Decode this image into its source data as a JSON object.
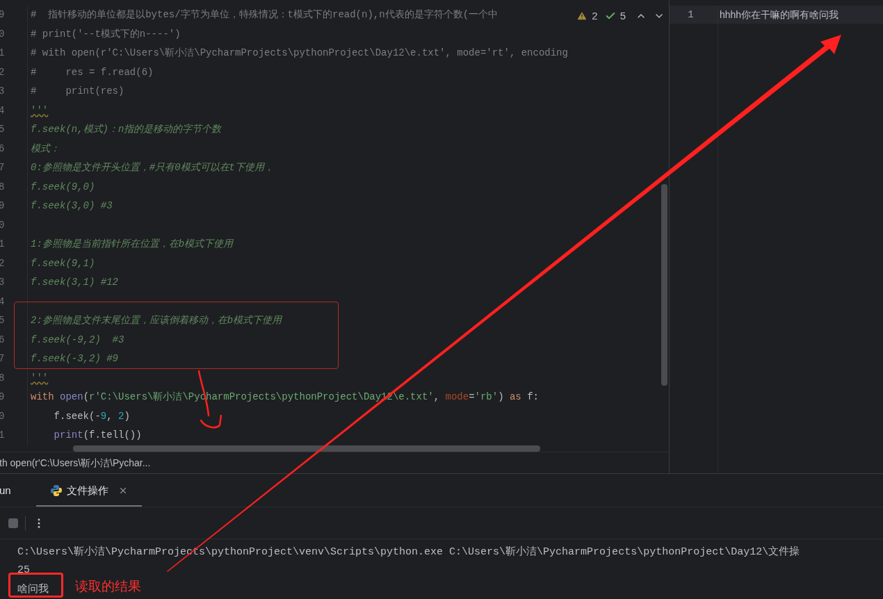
{
  "editor": {
    "lines": [
      {
        "number": "9",
        "segments": [
          {
            "kind": "comment",
            "text": "#  指针移动的单位都是以bytes/字节为单位，特殊情况：t模式下的read(n),n代表的是字符个数(一个中"
          }
        ]
      },
      {
        "number": "0",
        "segments": [
          {
            "kind": "comment",
            "text": "# print('--t模式下的n----')"
          }
        ]
      },
      {
        "number": "1",
        "segments": [
          {
            "kind": "comment",
            "text": "# with open(r'C:\\Users\\靳小洁\\PycharmProjects\\pythonProject\\Day12\\e.txt', mode='rt', encoding"
          }
        ]
      },
      {
        "number": "2",
        "segments": [
          {
            "kind": "comment",
            "text": "#     res = f.read(6)"
          }
        ]
      },
      {
        "number": "3",
        "segments": [
          {
            "kind": "comment",
            "text": "#     print(res)"
          }
        ]
      },
      {
        "number": "4",
        "segments": [
          {
            "kind": "quote",
            "text": "'''"
          }
        ]
      },
      {
        "number": "5",
        "segments": [
          {
            "kind": "doc",
            "text": "f.seek(n,模式)：n指的是移动的字节个数"
          }
        ]
      },
      {
        "number": "6",
        "segments": [
          {
            "kind": "doc",
            "text": "模式："
          }
        ]
      },
      {
        "number": "7",
        "segments": [
          {
            "kind": "doc",
            "text": "0:参照物是文件开头位置，#只有0模式可以在t下使用，"
          }
        ]
      },
      {
        "number": "8",
        "segments": [
          {
            "kind": "doc",
            "text": "f.seek(9,0)"
          }
        ]
      },
      {
        "number": "9",
        "segments": [
          {
            "kind": "doc",
            "text": "f.seek(3,0) #3"
          }
        ]
      },
      {
        "number": "0"
      },
      {
        "number": "1",
        "segments": [
          {
            "kind": "doc",
            "text": "1:参照物是当前指针所在位置，在b模式下使用"
          }
        ]
      },
      {
        "number": "2",
        "segments": [
          {
            "kind": "doc",
            "text": "f.seek(9,1)"
          }
        ]
      },
      {
        "number": "3",
        "segments": [
          {
            "kind": "doc",
            "text": "f.seek(3,1) #12"
          }
        ]
      },
      {
        "number": "4"
      },
      {
        "number": "5",
        "segments": [
          {
            "kind": "doc",
            "text": "2:参照物是文件末尾位置，应该倒着移动，在b模式下使用"
          }
        ]
      },
      {
        "number": "6",
        "segments": [
          {
            "kind": "doc",
            "text": "f.seek(-9,2)  #3"
          }
        ]
      },
      {
        "number": "7",
        "segments": [
          {
            "kind": "doc",
            "text": "f.seek(-3,2) #9"
          }
        ]
      },
      {
        "number": "8",
        "segments": [
          {
            "kind": "quote",
            "text": "'''"
          }
        ]
      },
      {
        "number": "9",
        "segments": [
          {
            "kind": "keyword",
            "text": "with "
          },
          {
            "kind": "builtin",
            "text": "open"
          },
          {
            "kind": "plain",
            "text": "("
          },
          {
            "kind": "string",
            "text": "r'C:\\Users\\靳小洁\\PycharmProjects\\pythonProject\\Day12\\e.txt'"
          },
          {
            "kind": "plain",
            "text": ", "
          },
          {
            "kind": "param",
            "text": "mode"
          },
          {
            "kind": "plain",
            "text": "="
          },
          {
            "kind": "string",
            "text": "'rb'"
          },
          {
            "kind": "plain",
            "text": ") "
          },
          {
            "kind": "keyword",
            "text": "as"
          },
          {
            "kind": "plain",
            "text": " f:"
          }
        ]
      },
      {
        "number": "0",
        "segments": [
          {
            "kind": "plain",
            "text": "    f.seek(-"
          },
          {
            "kind": "number",
            "text": "9"
          },
          {
            "kind": "plain",
            "text": ", "
          },
          {
            "kind": "number",
            "text": "2"
          },
          {
            "kind": "plain",
            "text": ")"
          }
        ]
      },
      {
        "number": "1",
        "segments": [
          {
            "kind": "builtin",
            "text": "    print"
          },
          {
            "kind": "plain",
            "text": "(f.tell())"
          }
        ]
      }
    ],
    "inspections": {
      "warnings": "2",
      "typos": "5"
    },
    "breadcrumb": "th open(r'C:\\Users\\靳小洁\\Pychar..."
  },
  "preview": {
    "lines": [
      {
        "number": "1",
        "text": "hhhh你在干嘛的啊有啥问我",
        "highlighted": true
      }
    ]
  },
  "run_panel": {
    "tabs": [
      {
        "label": "un",
        "kind": "plain",
        "selected": false
      },
      {
        "label": "文件操作",
        "kind": "python",
        "selected": true
      }
    ],
    "console": [
      "C:\\Users\\靳小洁\\PycharmProjects\\pythonProject\\venv\\Scripts\\python.exe C:\\Users\\靳小洁\\PycharmProjects\\pythonProject\\Day12\\文件操",
      "25",
      "啥问我"
    ]
  },
  "annotation": {
    "label": "读取的结果"
  }
}
